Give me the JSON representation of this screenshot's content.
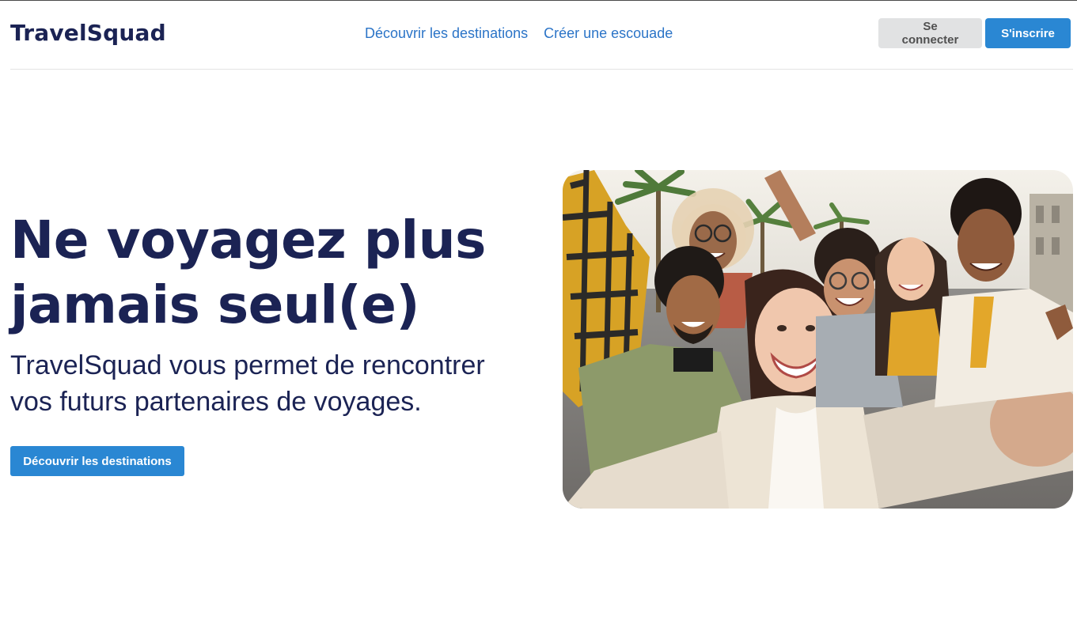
{
  "header": {
    "logo": "TravelSquad",
    "nav": [
      {
        "label": "Découvrir les destinations"
      },
      {
        "label": "Créer une escouade"
      }
    ],
    "login_label": "Se connecter",
    "signup_label": "S'inscrire"
  },
  "hero": {
    "title_line1": "Ne voyagez plus",
    "title_line2": "jamais seul(e)",
    "subtitle_line1": "TravelSquad vous permet de rencontrer",
    "subtitle_line2": "vos futurs partenaires de voyages.",
    "cta_label": "Découvrir les destinations"
  },
  "colors": {
    "brand_dark": "#1b2354",
    "accent_blue": "#2a87d3",
    "link_blue": "#2b74c7",
    "neutral_button": "#e1e2e3"
  }
}
